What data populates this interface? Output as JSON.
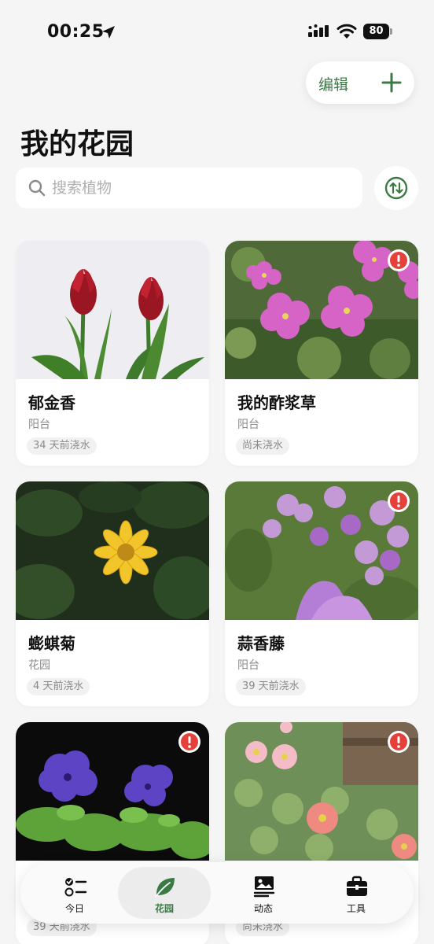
{
  "status": {
    "time": "00:25",
    "battery": "80"
  },
  "header": {
    "edit_label": "编辑",
    "title": "我的花园"
  },
  "search": {
    "placeholder": "搜索植物"
  },
  "plants": [
    {
      "name": "郁金香",
      "location": "阳台",
      "watered": "34 天前浇水",
      "alert": false
    },
    {
      "name": "我的酢浆草",
      "location": "阳台",
      "watered": "尚未浇水",
      "alert": true
    },
    {
      "name": "蟛蜞菊",
      "location": "花园",
      "watered": "4 天前浇水",
      "alert": false
    },
    {
      "name": "蒜香藤",
      "location": "阳台",
      "watered": "39 天前浇水",
      "alert": true
    },
    {
      "name": "",
      "location": "",
      "watered": "39 天前浇水",
      "alert": true
    },
    {
      "name": "",
      "location": "",
      "watered": "尚未浇水",
      "alert": true
    }
  ],
  "tabs": [
    {
      "label": "今日",
      "icon": "checklist-icon",
      "active": false
    },
    {
      "label": "花园",
      "icon": "leaf-icon",
      "active": true
    },
    {
      "label": "动态",
      "icon": "photo-feed-icon",
      "active": false
    },
    {
      "label": "工具",
      "icon": "toolbox-icon",
      "active": false
    }
  ],
  "colors": {
    "accent": "#3b7a45",
    "alert": "#e5413a",
    "background": "#f4f5f4"
  }
}
